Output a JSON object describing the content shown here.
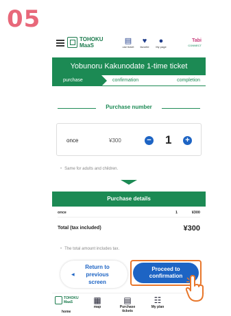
{
  "step_number": "05",
  "header": {
    "logo_line1": "TOHOKU",
    "logo_line2": "MaaS",
    "icons": [
      {
        "icon": "ticket-icon",
        "label": "use ticket"
      },
      {
        "icon": "heart-icon",
        "label": "favorite"
      },
      {
        "icon": "person-icon",
        "label": "My page"
      }
    ],
    "partner_logo": "Tabi",
    "partner_sub": "CONNECT"
  },
  "title": "Yobunoru Kakunodate 1-time ticket",
  "steps": {
    "active": "purchase",
    "second": "confirmation",
    "third": "completion"
  },
  "purchase_number": {
    "heading": "Purchase number",
    "item_name": "once",
    "item_price": "¥300",
    "quantity": "1",
    "minus_label": "−",
    "plus_label": "+"
  },
  "note_same": "Same for adults and children.",
  "details": {
    "heading": "Purchase details",
    "item_name": "once",
    "item_count": "1",
    "item_price": "¥300",
    "total_label": "Total (tax included)",
    "total_value": "¥300"
  },
  "note_tax": "The total amount includes tax.",
  "buttons": {
    "back_line1": "Return to",
    "back_line2": "previous",
    "back_line3": "screen",
    "proceed_line1": "Proceed to",
    "proceed_line2": "confirmation"
  },
  "bottom_nav": {
    "logo_line1": "TOHOKU",
    "logo_line2": "MaaS",
    "home": "home",
    "map": "map",
    "purchase_line1": "Purchase",
    "purchase_line2": "tickets",
    "myplan": "My plan"
  },
  "colors": {
    "green": "#1c8a54",
    "blue": "#1d64c4",
    "highlight": "#e8762a",
    "step_number": "#e8687a"
  }
}
